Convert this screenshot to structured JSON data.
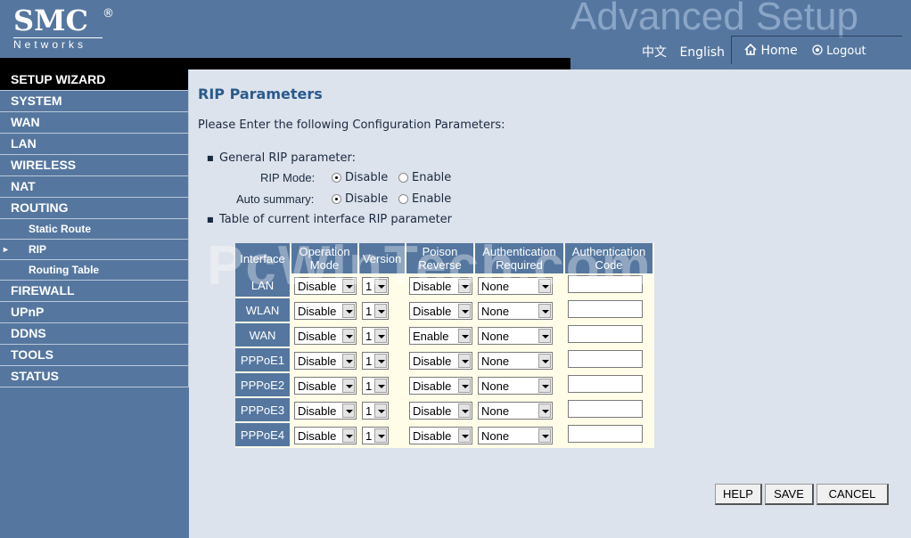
{
  "header": {
    "brand": "SMC",
    "brand_mark": "®",
    "brand_sub": "Networks",
    "banner": "Advanced Setup",
    "lang_chinese": "中文",
    "lang_english": "English",
    "home_label": "Home",
    "logout_label": "Logout"
  },
  "sidebar": {
    "items": [
      {
        "label": "SETUP WIZARD"
      },
      {
        "label": "SYSTEM"
      },
      {
        "label": "WAN"
      },
      {
        "label": "LAN"
      },
      {
        "label": "WIRELESS"
      },
      {
        "label": "NAT"
      },
      {
        "label": "ROUTING"
      },
      {
        "label": "Static Route"
      },
      {
        "label": "RIP"
      },
      {
        "label": "Routing Table"
      },
      {
        "label": "FIREWALL"
      },
      {
        "label": "UPnP"
      },
      {
        "label": "DDNS"
      },
      {
        "label": "TOOLS"
      },
      {
        "label": "STATUS"
      }
    ]
  },
  "main": {
    "title": "RIP Parameters",
    "intro": "Please Enter the following Configuration Parameters:",
    "general_label": "General RIP parameter:",
    "rip_mode_label": "RIP Mode:",
    "auto_summary_label": "Auto summary:",
    "disable_label": "Disable",
    "enable_label": "Enable",
    "table_caption": "Table of current interface RIP parameter",
    "watermark": "PcWinTech.com"
  },
  "table": {
    "headers": {
      "interface": "Interface",
      "operation": "Operation Mode",
      "version": "Version",
      "poison": "Poison Reverse",
      "auth_req": "Authentication Required",
      "auth_code": "Authentication Code"
    },
    "rows": [
      {
        "iface": "LAN",
        "op": "Disable",
        "ver": "1",
        "poison": "Disable",
        "auth": "None",
        "code": ""
      },
      {
        "iface": "WLAN",
        "op": "Disable",
        "ver": "1",
        "poison": "Disable",
        "auth": "None",
        "code": ""
      },
      {
        "iface": "WAN",
        "op": "Disable",
        "ver": "1",
        "poison": "Enable",
        "auth": "None",
        "code": ""
      },
      {
        "iface": "PPPoE1",
        "op": "Disable",
        "ver": "1",
        "poison": "Disable",
        "auth": "None",
        "code": ""
      },
      {
        "iface": "PPPoE2",
        "op": "Disable",
        "ver": "1",
        "poison": "Disable",
        "auth": "None",
        "code": ""
      },
      {
        "iface": "PPPoE3",
        "op": "Disable",
        "ver": "1",
        "poison": "Disable",
        "auth": "None",
        "code": ""
      },
      {
        "iface": "PPPoE4",
        "op": "Disable",
        "ver": "1",
        "poison": "Disable",
        "auth": "None",
        "code": ""
      }
    ]
  },
  "buttons": {
    "help": "HELP",
    "save": "SAVE",
    "cancel": "CANCEL"
  },
  "colors": {
    "nav_blue": "#55779f",
    "page_bg": "#dde3ec",
    "title_blue": "#2a5a8c",
    "cell_bg": "#fffde8"
  }
}
